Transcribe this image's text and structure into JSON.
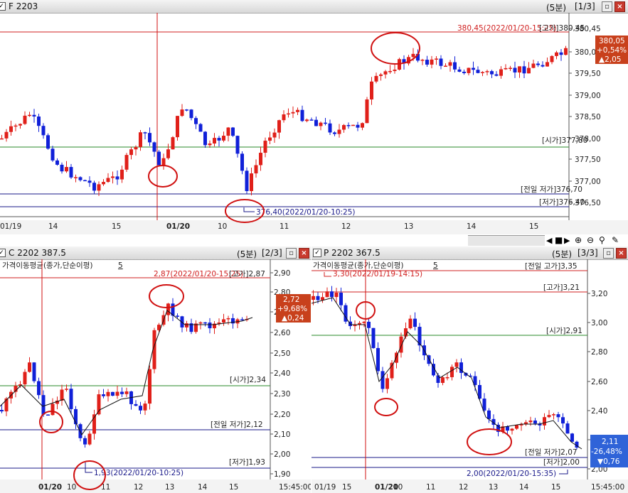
{
  "colors": {
    "up": "#e0201a",
    "down": "#1020d8",
    "open_line": "#2a8a2a",
    "high_line": "#d02020",
    "low_line": "#1a1a8a",
    "marker": "#d01010",
    "ma": "#111111"
  },
  "top": {
    "title": "F 2203",
    "interval": "(5분)",
    "page": "[1/3]",
    "dropdown_icon": "chevron-down-icon",
    "yticks": [
      "380,45",
      "380,00",
      "379,50",
      "379,00",
      "378,50",
      "378,00",
      "377,50",
      "377,00",
      "376,50"
    ],
    "xticks": [
      "01/19",
      "14",
      "15",
      "01/20",
      "10",
      "11",
      "12",
      "13",
      "14",
      "15"
    ],
    "ref_labels": {
      "high": "[고가]380,45",
      "open": "[시가]377,80",
      "prev_low": "[전일 저가]376,70",
      "low": "[저가]376,40"
    },
    "high_annot": "380,45(2022/01/20-15:25)",
    "low_annot": "376,40(2022/01/20-10:25)",
    "badge": {
      "price": "380,05",
      "pct": "+0,54%",
      "chg": "▲2,05"
    }
  },
  "bottom_left": {
    "title": "C 2202 387.5",
    "interval": "(5분)",
    "page": "[2/3]",
    "indicator": "가격이동평균(종가,단순이평)",
    "indicator_period": "5",
    "yticks": [
      "2,90",
      "2,80",
      "2,70",
      "2,60",
      "2,50",
      "2,40",
      "2,30",
      "2,20",
      "2,10",
      "2,00",
      "1,90"
    ],
    "xticks": [
      "01/20",
      "10",
      "11",
      "12",
      "13",
      "14",
      "15",
      "15:45:00"
    ],
    "ref_labels": {
      "high": "[고가]2,87",
      "open": "[시가]2,34",
      "prev_low": "[전일 저가]2,12",
      "low": "[저가]1,93"
    },
    "high_annot": "2,87(2022/01/20-15:25)",
    "low_annot": "1,93(2022/01/20-10:25)",
    "badge": {
      "price": "2,72",
      "pct": "+9,68%",
      "chg": "▲0,24"
    }
  },
  "bottom_right": {
    "title": "P 2202 367.5",
    "interval": "(5분)",
    "page": "[3/3]",
    "indicator": "가격이동평균(종가,단순이평)",
    "indicator_period": "5",
    "yticks": [
      "3,20",
      "3,00",
      "2,80",
      "2,60",
      "2,40",
      "2,20",
      "2,00"
    ],
    "xticks": [
      "01/19",
      "15",
      "01/20",
      "10",
      "11",
      "12",
      "13",
      "14",
      "15",
      "15:45:00"
    ],
    "ref_labels": {
      "prev_high": "[전일 고가]3,35",
      "high": "[고가]3,21",
      "open": "[시가]2,91",
      "prev_low": "[전일 저가]2,07",
      "low": "[저가]2,00"
    },
    "high_annot": "3,30(2022/01/19-14:15)",
    "low_annot": "2,00(2022/01/20-15:35)",
    "badge": {
      "price": "2,11",
      "pct": "-26,48%",
      "chg": "▼0,76"
    }
  },
  "toolbar": {
    "icons": [
      "scroll-left-icon",
      "stop-icon",
      "scroll-right-icon",
      "zoom-in-icon",
      "zoom-out-icon",
      "search-icon",
      "tools-icon"
    ]
  }
}
